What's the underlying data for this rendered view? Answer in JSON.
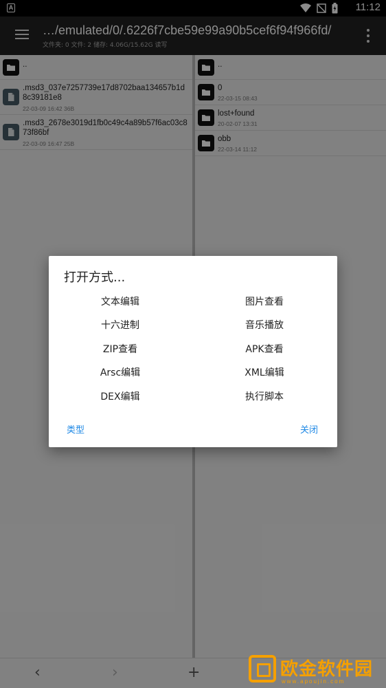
{
  "status_bar": {
    "time": "11:12",
    "app_badge": "A"
  },
  "toolbar": {
    "path": "…/emulated/0/.6226f7cbe59e99a90b5cef6f94f966fd/",
    "summary": "文件夹: 0  文件: 2  储存: 4.06G/15.62G  读写"
  },
  "left_pane": {
    "items": [
      {
        "icon": "folder-icon",
        "name": "..",
        "meta": ""
      },
      {
        "icon": "file-icon",
        "name": ".msd3_037e7257739e17d8702baa134657b1d8c39181e8",
        "meta": "22-03-09 16:42  36B"
      },
      {
        "icon": "file-icon",
        "name": ".msd3_2678e3019d1fb0c49c4a89b57f6ac03c873f86bf",
        "meta": "22-03-09 16:47  25B"
      }
    ]
  },
  "right_pane": {
    "items": [
      {
        "icon": "folder-icon",
        "name": "..",
        "meta": ""
      },
      {
        "icon": "folder-icon",
        "name": "0",
        "meta": "22-03-15 08:43"
      },
      {
        "icon": "folder-icon",
        "name": "lost+found",
        "meta": "20-02-07 13:31"
      },
      {
        "icon": "folder-icon",
        "name": "obb",
        "meta": "22-03-14 11:12"
      }
    ]
  },
  "dialog": {
    "title": "打开方式...",
    "options": [
      [
        "文本编辑",
        "图片查看"
      ],
      [
        "十六进制",
        "音乐播放"
      ],
      [
        "ZIP查看",
        "APK查看"
      ],
      [
        "Arsc编辑",
        "XML编辑"
      ],
      [
        "DEX编辑",
        "执行脚本"
      ]
    ],
    "type_button": "类型",
    "close_button": "关闭"
  },
  "bottom_bar": {
    "back": "‹",
    "forward": "›",
    "add": "+"
  },
  "watermark": {
    "text": "欧金软件园",
    "url": "www.apoujin.com"
  },
  "colors": {
    "accent": "#1e88e5",
    "toolbar": "#212121",
    "watermark": "#f5a000"
  }
}
